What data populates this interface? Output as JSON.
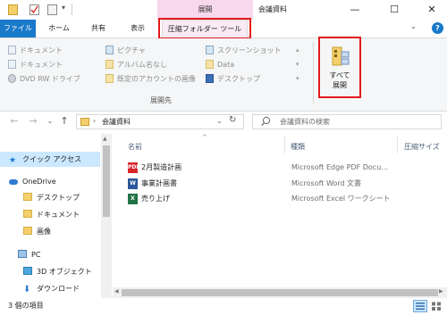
{
  "window": {
    "title": "会議資料",
    "context_tab_header": "展開",
    "controls": {
      "minimize": "—",
      "maximize": "☐",
      "close": "✕"
    }
  },
  "tabs": {
    "file": "ファイル",
    "home": "ホーム",
    "share": "共有",
    "view": "表示",
    "compressed_folder_tools": "圧縮フォルダー ツール"
  },
  "ribbon": {
    "collapse_glyph": "⌄",
    "help_glyph": "?",
    "column1": [
      "ドキュメント",
      "ドキュメント",
      "DVD RW ドライブ"
    ],
    "column2": [
      "ピクチャ",
      "アルバム名なし",
      "既定のアカウントの画像"
    ],
    "column3": [
      "スクリーンショット",
      "Data",
      "デスクトップ"
    ],
    "group_label": "展開先",
    "extract_all_line1": "すべて",
    "extract_all_line2": "展開"
  },
  "nav": {
    "back": "←",
    "forward": "→",
    "recent": "⌄",
    "up": "↑",
    "address_path": "会議資料",
    "address_sep": "›",
    "dropdown": "⌄",
    "refresh": "↻",
    "search_placeholder": "会議資料の検索"
  },
  "navpane": {
    "items": [
      {
        "label": "クイック アクセス",
        "icon": "star-icon"
      },
      {
        "label": "OneDrive",
        "icon": "cloud-icon"
      },
      {
        "label": "デスクトップ",
        "icon": "folder-icon"
      },
      {
        "label": "ドキュメント",
        "icon": "folder-icon"
      },
      {
        "label": "画像",
        "icon": "folder-icon"
      },
      {
        "label": "PC",
        "icon": "computer-icon"
      },
      {
        "label": "3D オブジェクト",
        "icon": "cube-icon"
      },
      {
        "label": "ダウンロード",
        "icon": "download-icon"
      }
    ]
  },
  "filelist": {
    "columns": [
      "名前",
      "種類",
      "圧縮サイズ"
    ],
    "sort_glyph": "^",
    "rows": [
      {
        "name": "2月製造計画",
        "type": "Microsoft Edge PDF Docu...",
        "icon": "pdf-icon",
        "badge": "PDF",
        "color": "#d9262b"
      },
      {
        "name": "事業計画書",
        "type": "Microsoft Word 文書",
        "icon": "word-icon",
        "badge": "W",
        "color": "#2b579a"
      },
      {
        "name": "売り上げ",
        "type": "Microsoft Excel ワークシート",
        "icon": "excel-icon",
        "badge": "X",
        "color": "#217346"
      }
    ]
  },
  "status": {
    "count": "3 個の項目"
  },
  "colors": {
    "accent": "#1979ca",
    "context_tab": "#f7d8ec",
    "highlight_box": "#e31a1a"
  }
}
